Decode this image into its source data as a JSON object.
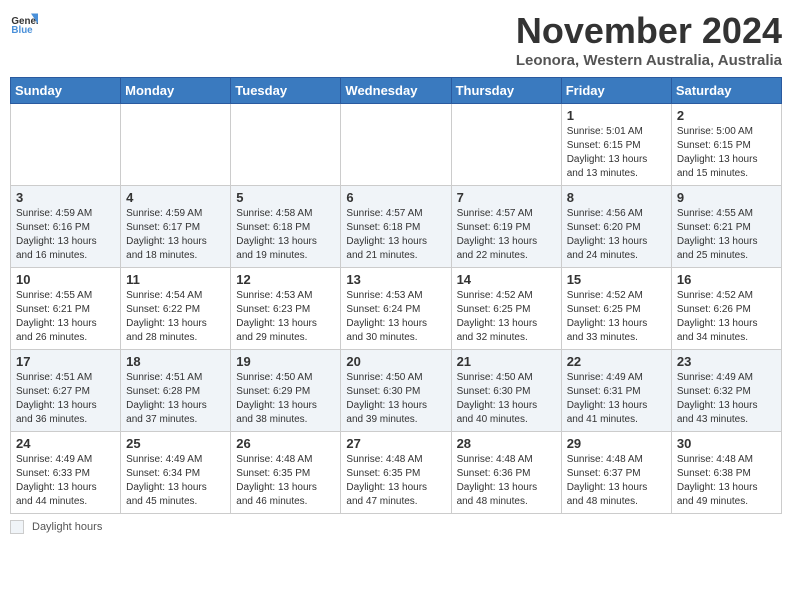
{
  "logo": {
    "general": "General",
    "blue": "Blue"
  },
  "title": "November 2024",
  "location": "Leonora, Western Australia, Australia",
  "days_of_week": [
    "Sunday",
    "Monday",
    "Tuesday",
    "Wednesday",
    "Thursday",
    "Friday",
    "Saturday"
  ],
  "legend_label": "Daylight hours",
  "weeks": [
    [
      {
        "day": "",
        "info": ""
      },
      {
        "day": "",
        "info": ""
      },
      {
        "day": "",
        "info": ""
      },
      {
        "day": "",
        "info": ""
      },
      {
        "day": "",
        "info": ""
      },
      {
        "day": "1",
        "info": "Sunrise: 5:01 AM\nSunset: 6:15 PM\nDaylight: 13 hours and 13 minutes."
      },
      {
        "day": "2",
        "info": "Sunrise: 5:00 AM\nSunset: 6:15 PM\nDaylight: 13 hours and 15 minutes."
      }
    ],
    [
      {
        "day": "3",
        "info": "Sunrise: 4:59 AM\nSunset: 6:16 PM\nDaylight: 13 hours and 16 minutes."
      },
      {
        "day": "4",
        "info": "Sunrise: 4:59 AM\nSunset: 6:17 PM\nDaylight: 13 hours and 18 minutes."
      },
      {
        "day": "5",
        "info": "Sunrise: 4:58 AM\nSunset: 6:18 PM\nDaylight: 13 hours and 19 minutes."
      },
      {
        "day": "6",
        "info": "Sunrise: 4:57 AM\nSunset: 6:18 PM\nDaylight: 13 hours and 21 minutes."
      },
      {
        "day": "7",
        "info": "Sunrise: 4:57 AM\nSunset: 6:19 PM\nDaylight: 13 hours and 22 minutes."
      },
      {
        "day": "8",
        "info": "Sunrise: 4:56 AM\nSunset: 6:20 PM\nDaylight: 13 hours and 24 minutes."
      },
      {
        "day": "9",
        "info": "Sunrise: 4:55 AM\nSunset: 6:21 PM\nDaylight: 13 hours and 25 minutes."
      }
    ],
    [
      {
        "day": "10",
        "info": "Sunrise: 4:55 AM\nSunset: 6:21 PM\nDaylight: 13 hours and 26 minutes."
      },
      {
        "day": "11",
        "info": "Sunrise: 4:54 AM\nSunset: 6:22 PM\nDaylight: 13 hours and 28 minutes."
      },
      {
        "day": "12",
        "info": "Sunrise: 4:53 AM\nSunset: 6:23 PM\nDaylight: 13 hours and 29 minutes."
      },
      {
        "day": "13",
        "info": "Sunrise: 4:53 AM\nSunset: 6:24 PM\nDaylight: 13 hours and 30 minutes."
      },
      {
        "day": "14",
        "info": "Sunrise: 4:52 AM\nSunset: 6:25 PM\nDaylight: 13 hours and 32 minutes."
      },
      {
        "day": "15",
        "info": "Sunrise: 4:52 AM\nSunset: 6:25 PM\nDaylight: 13 hours and 33 minutes."
      },
      {
        "day": "16",
        "info": "Sunrise: 4:52 AM\nSunset: 6:26 PM\nDaylight: 13 hours and 34 minutes."
      }
    ],
    [
      {
        "day": "17",
        "info": "Sunrise: 4:51 AM\nSunset: 6:27 PM\nDaylight: 13 hours and 36 minutes."
      },
      {
        "day": "18",
        "info": "Sunrise: 4:51 AM\nSunset: 6:28 PM\nDaylight: 13 hours and 37 minutes."
      },
      {
        "day": "19",
        "info": "Sunrise: 4:50 AM\nSunset: 6:29 PM\nDaylight: 13 hours and 38 minutes."
      },
      {
        "day": "20",
        "info": "Sunrise: 4:50 AM\nSunset: 6:30 PM\nDaylight: 13 hours and 39 minutes."
      },
      {
        "day": "21",
        "info": "Sunrise: 4:50 AM\nSunset: 6:30 PM\nDaylight: 13 hours and 40 minutes."
      },
      {
        "day": "22",
        "info": "Sunrise: 4:49 AM\nSunset: 6:31 PM\nDaylight: 13 hours and 41 minutes."
      },
      {
        "day": "23",
        "info": "Sunrise: 4:49 AM\nSunset: 6:32 PM\nDaylight: 13 hours and 43 minutes."
      }
    ],
    [
      {
        "day": "24",
        "info": "Sunrise: 4:49 AM\nSunset: 6:33 PM\nDaylight: 13 hours and 44 minutes."
      },
      {
        "day": "25",
        "info": "Sunrise: 4:49 AM\nSunset: 6:34 PM\nDaylight: 13 hours and 45 minutes."
      },
      {
        "day": "26",
        "info": "Sunrise: 4:48 AM\nSunset: 6:35 PM\nDaylight: 13 hours and 46 minutes."
      },
      {
        "day": "27",
        "info": "Sunrise: 4:48 AM\nSunset: 6:35 PM\nDaylight: 13 hours and 47 minutes."
      },
      {
        "day": "28",
        "info": "Sunrise: 4:48 AM\nSunset: 6:36 PM\nDaylight: 13 hours and 48 minutes."
      },
      {
        "day": "29",
        "info": "Sunrise: 4:48 AM\nSunset: 6:37 PM\nDaylight: 13 hours and 48 minutes."
      },
      {
        "day": "30",
        "info": "Sunrise: 4:48 AM\nSunset: 6:38 PM\nDaylight: 13 hours and 49 minutes."
      }
    ]
  ]
}
